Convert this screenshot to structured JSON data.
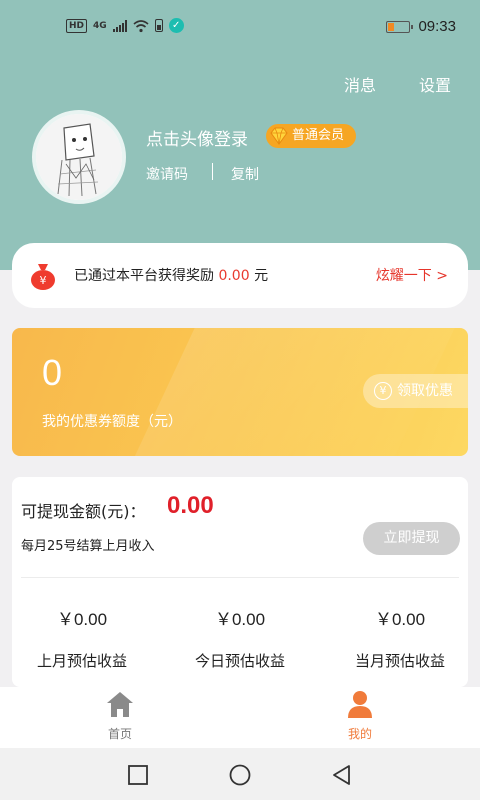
{
  "status_bar": {
    "left_badges": [
      "HD",
      "4G"
    ],
    "time": "09:33"
  },
  "header": {
    "messages_label": "消息",
    "settings_label": "设置",
    "login_prompt": "点击头像登录",
    "member_level": "普通会员",
    "invite_code_label": "邀请码",
    "copy_label": "复制"
  },
  "reward": {
    "text_prefix": "已通过本平台获得奖励",
    "amount": "0.00",
    "unit": "元",
    "show_off_link": "炫耀一下 >"
  },
  "coupon": {
    "amount": "0",
    "label": "我的优惠券额度（元）",
    "claim_button": "领取优惠",
    "claim_icon_glyph": "¥"
  },
  "earnings": {
    "withdrawable_label": "可提现金额(元)：",
    "withdrawable_amount": "0.00",
    "settlement_note": "每月25号结算上月收入",
    "withdraw_button": "立即提现",
    "stats": [
      {
        "value": "￥0.00",
        "label": "上月预估收益"
      },
      {
        "value": "￥0.00",
        "label": "今日预估收益"
      },
      {
        "value": "￥0.00",
        "label": "当月预估收益"
      }
    ]
  },
  "tabbar": {
    "home_label": "首页",
    "mine_label": "我的"
  },
  "colors": {
    "header_bg": "#92c2ba",
    "accent_red": "#e0202a",
    "coupon_gold": "#fac650",
    "vip_orange": "#f6a623",
    "tab_active": "#f07b3b"
  },
  "icons": {
    "status": [
      "signal-icon",
      "wifi-icon",
      "battery-icon",
      "verified-icon"
    ],
    "reward": "money-bag-icon",
    "vip": "diamond-icon",
    "tabs": [
      "home-icon",
      "user-icon"
    ],
    "nav": [
      "recent-apps-icon",
      "home-circle-icon",
      "back-icon"
    ]
  }
}
